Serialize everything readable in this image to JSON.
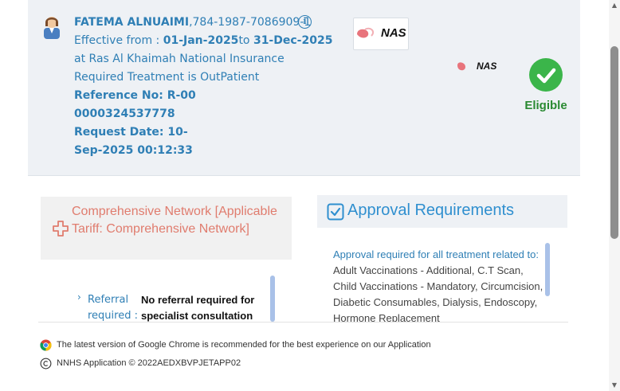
{
  "member": {
    "name": "FATEMA ALNUAIMI",
    "id": "784-1987-7086909-1",
    "effective_prefix": "Effective from : ",
    "effective_from": "01-Jan-2025",
    "effective_to_word": "to ",
    "effective_to": "31-Dec-2025",
    "insurer_line": "at Ras Al Khaimah National Insurance",
    "treatment_line": "Required Treatment is OutPatient",
    "reference": "Reference No: R-000000324537778",
    "request_date": "Request Date: 10-Sep-2025 00:12:33"
  },
  "logo": {
    "text": "NAS"
  },
  "eligibility": {
    "label": "Eligible",
    "color": "#3bb54a"
  },
  "network": {
    "text": "Comprehensive Network [Applicable Tariff: Comprehensive Network]"
  },
  "referral": {
    "label": "Referral required :",
    "value": "No referral required for specialist consultation"
  },
  "approval": {
    "title": "Approval Requirements",
    "intro": "Approval required for all treatment related to:",
    "items": "Adult Vaccinations - Additional, C.T Scan, Child Vaccinations - Mandatory, Circumcision, Diabetic Consumables, Dialysis, Endoscopy, Hormone Replacement"
  },
  "footer": {
    "chrome_note": "The latest version of Google Chrome is recommended for the best experience on our Application",
    "copyright": "NNHS Application © 2022AEDXBVPJETAPP02"
  }
}
